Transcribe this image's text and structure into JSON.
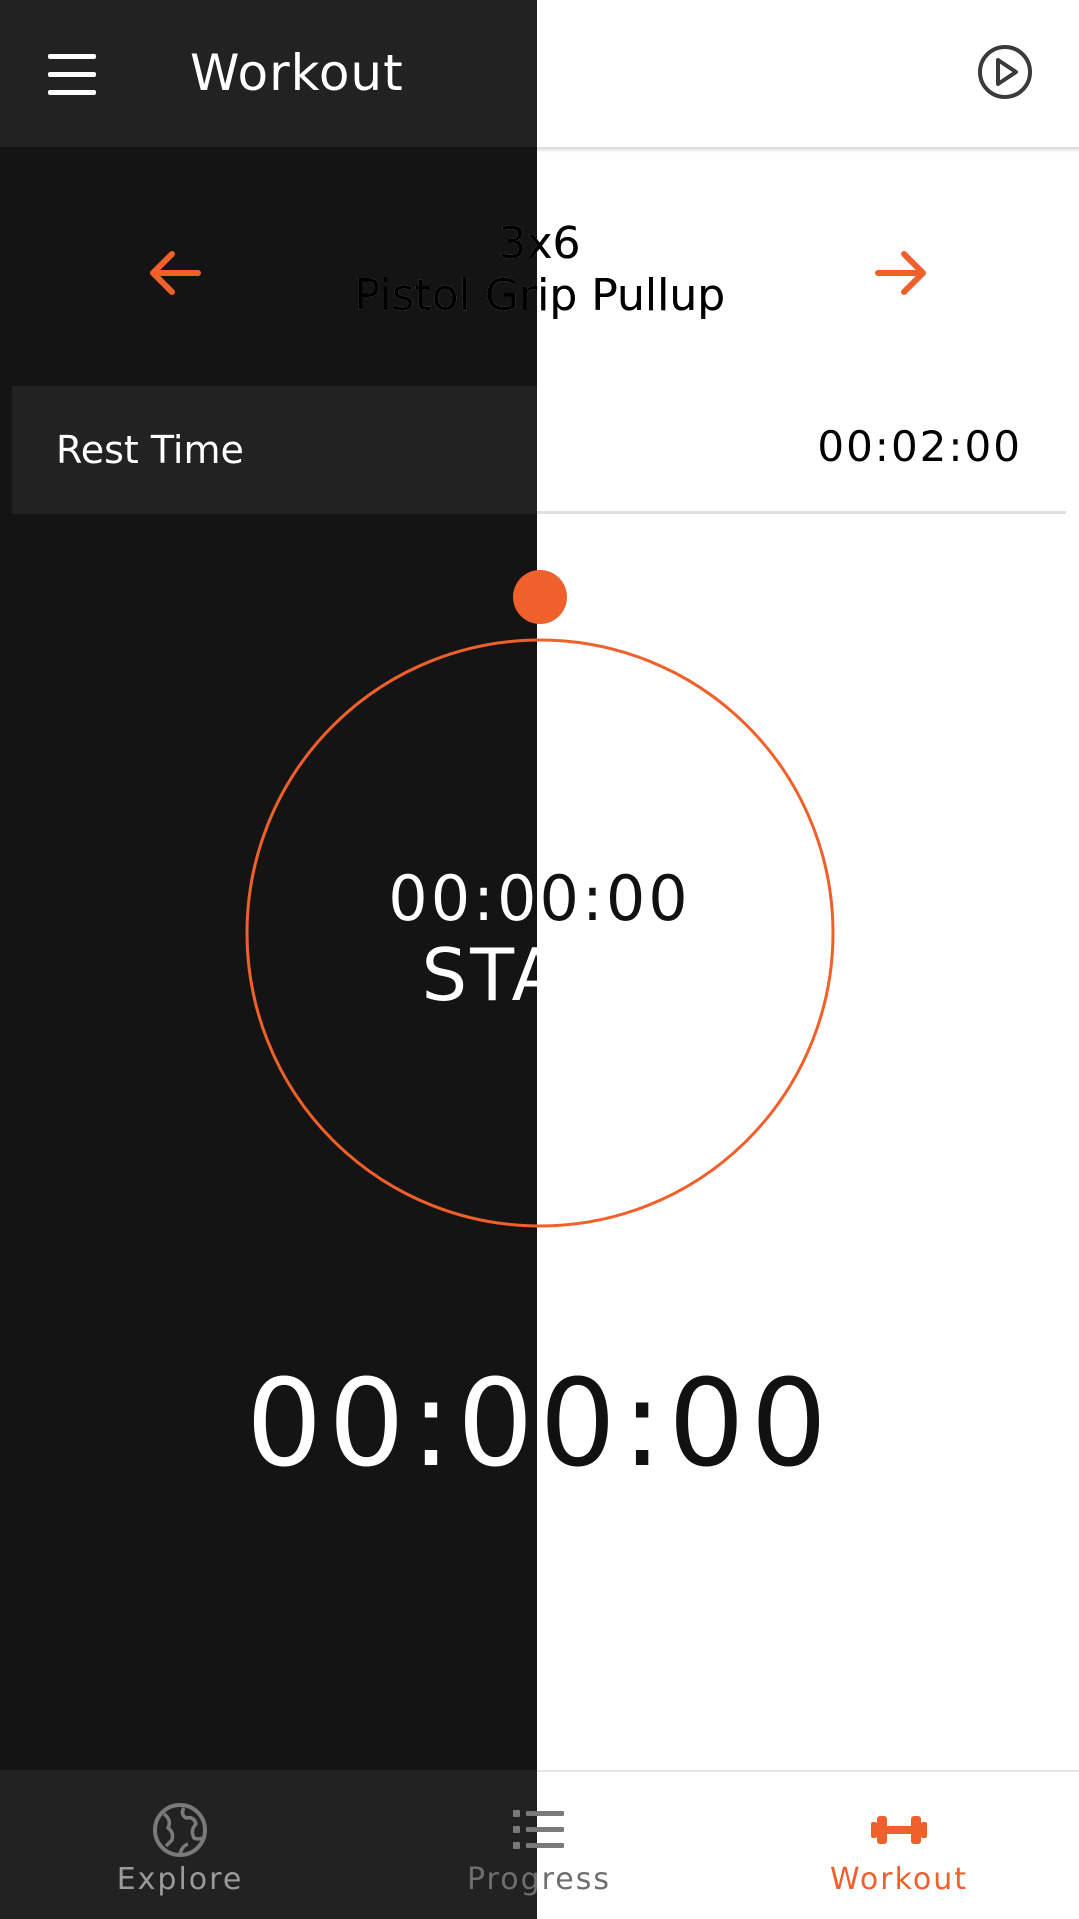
{
  "app_bar": {
    "title": "Workout",
    "menu_icon": "hamburger-menu-icon",
    "play_icon": "play-circle-icon"
  },
  "exercise": {
    "sets": "3x6",
    "name": "Pistol Grip Pullup",
    "prev_icon": "arrow-left-icon",
    "next_icon": "arrow-right-icon"
  },
  "rest": {
    "label": "Rest Time",
    "value": "00:02:00"
  },
  "timer": {
    "circle_time": "00:00:00",
    "start_label": "START",
    "big_time": "00:00:00",
    "progress": 0
  },
  "bottom_nav": {
    "items": [
      {
        "label": "Explore",
        "icon": "globe-icon",
        "active": false
      },
      {
        "label": "Progress",
        "icon": "list-icon",
        "active": false
      },
      {
        "label": "Workout",
        "icon": "dumbbell-icon",
        "active": true
      }
    ]
  },
  "colors": {
    "accent": "#F0602B",
    "dark_bg": "#141414",
    "dark_panel": "#222222",
    "inactive_icon": "#7a7a7a"
  }
}
